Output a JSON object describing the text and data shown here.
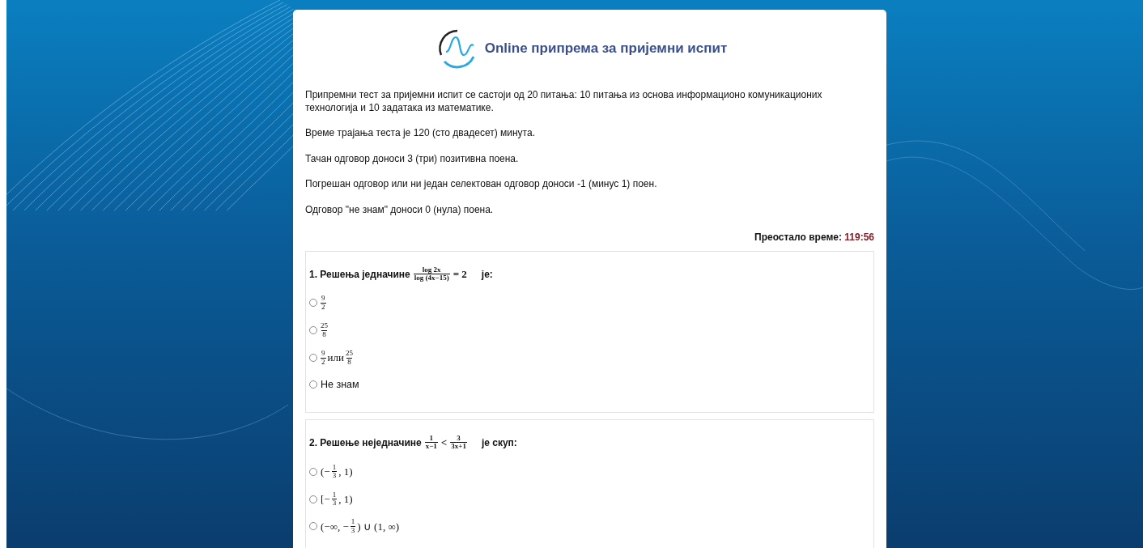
{
  "header": {
    "title": "Online припрема за пријемни испит"
  },
  "intro": [
    "Припремни тест за пријемни испит се састоји од 20 питања: 10 питања из основа информационо комуникационих технологија и 10 задатака из математике.",
    "Време трајања теста је 120 (сто двадесет) минута.",
    "Тачан одговор доноси 3 (три) позитивна поена.",
    "Погрешан одговор или ни један селектован одговор доноси -1 (минус 1) поен.",
    "Одговор \"не знам\" доноси 0 (нула) поена."
  ],
  "timer": {
    "label": "Преостало време:",
    "value": "119:56"
  },
  "questions": [
    {
      "number": "1.",
      "text": "Решења једначине",
      "math": [
        {
          "kind": "frac",
          "num": "log 2x",
          "den": "log (4x−15)"
        },
        {
          "kind": "text",
          "text": "= 2"
        }
      ],
      "suffix": "је:",
      "options": [
        {
          "selected": false,
          "parts": [
            {
              "kind": "frac",
              "num": "9",
              "den": "2"
            }
          ]
        },
        {
          "selected": false,
          "parts": [
            {
              "kind": "frac",
              "num": "25",
              "den": "8"
            }
          ]
        },
        {
          "selected": false,
          "parts": [
            {
              "kind": "frac",
              "num": "9",
              "den": "2"
            },
            {
              "kind": "text",
              "text": "или"
            },
            {
              "kind": "frac",
              "num": "25",
              "den": "8"
            }
          ]
        },
        {
          "selected": false,
          "parts": [
            {
              "kind": "plain",
              "text": "Не знам"
            }
          ]
        }
      ]
    },
    {
      "number": "2.",
      "text": "Решење неједначине",
      "math": [
        {
          "kind": "frac",
          "num": "1",
          "den": "x−1"
        },
        {
          "kind": "text",
          "text": "<"
        },
        {
          "kind": "frac",
          "num": "3",
          "den": "3x+1"
        }
      ],
      "suffix": "је скуп:",
      "options": [
        {
          "selected": false,
          "parts": [
            {
              "kind": "text",
              "text": "(−"
            },
            {
              "kind": "frac",
              "num": "1",
              "den": "3"
            },
            {
              "kind": "text",
              "text": ", 1)"
            }
          ]
        },
        {
          "selected": false,
          "parts": [
            {
              "kind": "text",
              "text": "[−"
            },
            {
              "kind": "frac",
              "num": "1",
              "den": "3"
            },
            {
              "kind": "text",
              "text": ", 1)"
            }
          ]
        },
        {
          "selected": false,
          "parts": [
            {
              "kind": "text",
              "text": "(−∞, −"
            },
            {
              "kind": "frac",
              "num": "1",
              "den": "3"
            },
            {
              "kind": "text",
              "text": ") ∪ (1, ∞)"
            }
          ]
        }
      ]
    }
  ]
}
